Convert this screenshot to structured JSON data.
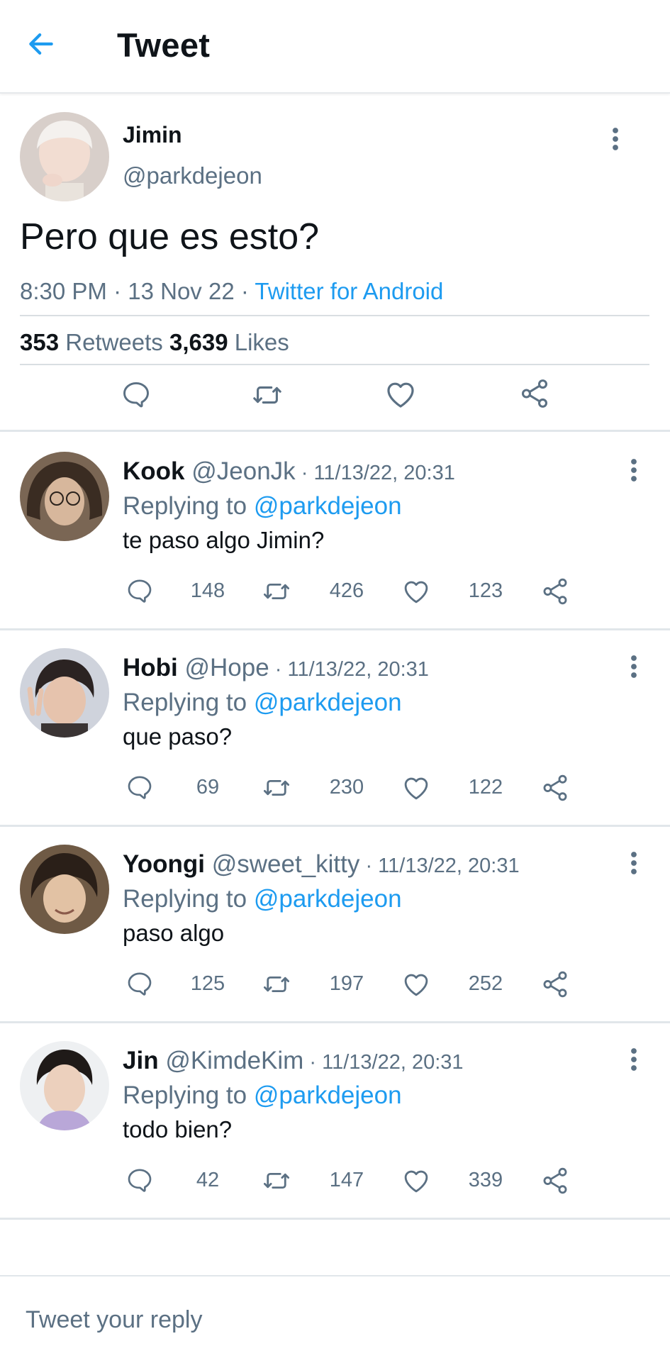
{
  "header": {
    "title": "Tweet",
    "back_icon": "arrow-left-icon",
    "accent": "#1d9bf0"
  },
  "main_tweet": {
    "name": "Jimin",
    "handle": "@parkdejeon",
    "text": "Pero que es esto?",
    "time": "8:30 PM",
    "date": "13 Nov 22",
    "source": "Twitter for Android",
    "retweets": "353",
    "retweets_label": "Retweets",
    "likes": "3,639",
    "likes_label": "Likes"
  },
  "replies": [
    {
      "name": "Kook",
      "handle": "@JeonJk",
      "date": "11/13/22, 20:31",
      "replying_prefix": "Replying to",
      "replying_to": "@parkdejeon",
      "text": "te paso algo Jimin?",
      "replies": "148",
      "retweets": "426",
      "likes": "123"
    },
    {
      "name": "Hobi",
      "handle": "@Hope",
      "date": "11/13/22, 20:31",
      "replying_prefix": "Replying to",
      "replying_to": "@parkdejeon",
      "text": "que paso?",
      "replies": "69",
      "retweets": "230",
      "likes": "122"
    },
    {
      "name": "Yoongi",
      "handle": "@sweet_kitty",
      "date": "11/13/22, 20:31",
      "replying_prefix": "Replying to",
      "replying_to": "@parkdejeon",
      "text": "paso algo",
      "replies": "125",
      "retweets": "197",
      "likes": "252"
    },
    {
      "name": "Jin",
      "handle": "@KimdeKim",
      "date": "11/13/22, 20:31",
      "replying_prefix": "Replying to",
      "replying_to": "@parkdejeon",
      "text": "todo bien?",
      "replies": "42",
      "retweets": "147",
      "likes": "339"
    }
  ],
  "compose": {
    "placeholder": "Tweet your reply"
  }
}
